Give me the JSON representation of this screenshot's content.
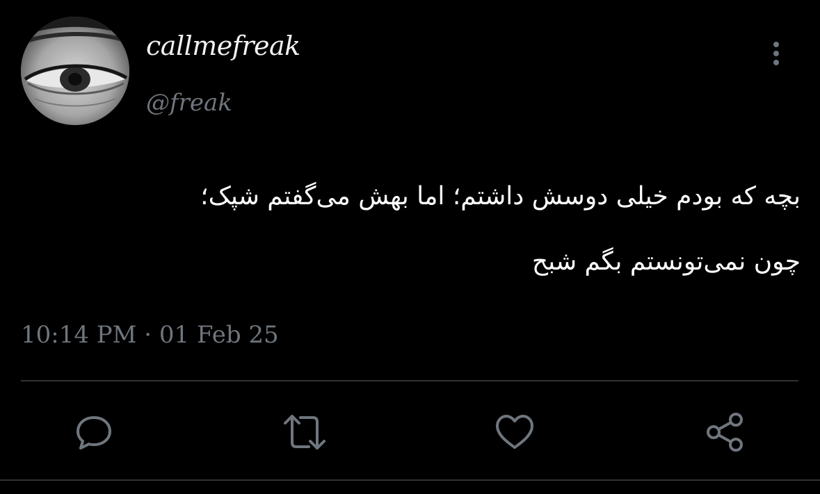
{
  "tweet": {
    "display_name": "callmefreak",
    "handle": "@freak",
    "text_lines": [
      "بچه که بودم خیلی دوسش داشتم؛ اما بهش می‌گفتم شپک؛",
      "چون نمی‌تونستم بگم شبح"
    ],
    "timestamp": "10:14 PM · 01 Feb 25"
  },
  "icons": {
    "more": "vertical-ellipsis-icon",
    "reply": "speech-bubble-icon",
    "retweet": "retweet-arrows-icon",
    "like": "heart-icon",
    "share": "share-nodes-icon"
  },
  "colors": {
    "background": "#000000",
    "text_primary": "#ffffff",
    "text_secondary": "#6f767d",
    "icon": "#6f767d",
    "divider": "#2f3336"
  }
}
